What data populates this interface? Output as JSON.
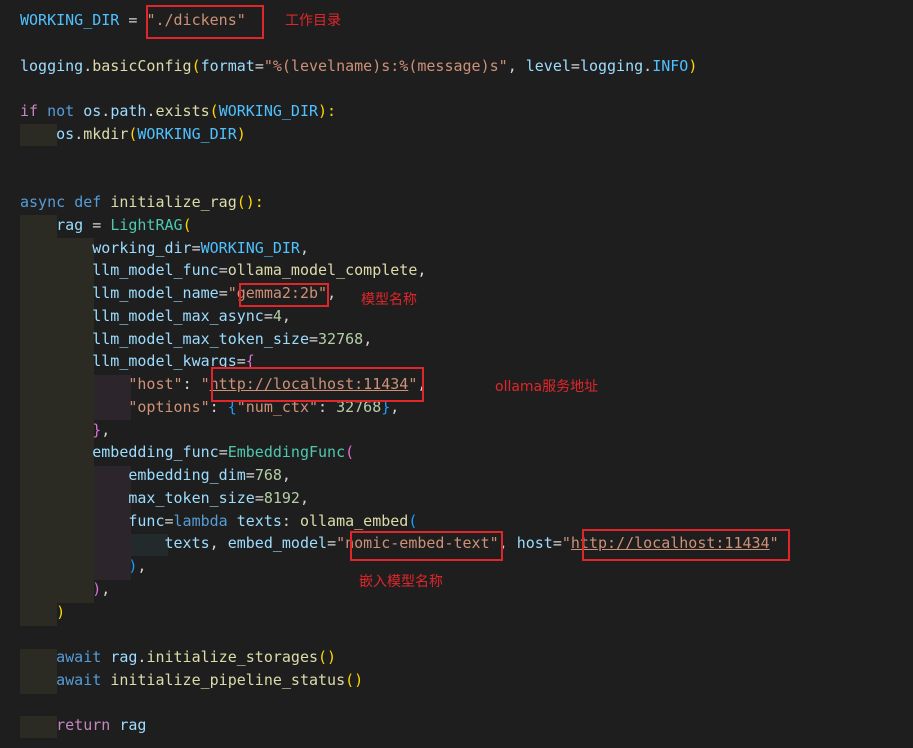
{
  "editor": {
    "lines": [
      [
        [
          "const",
          "WORKING_DIR"
        ],
        [
          "op",
          " = "
        ],
        [
          "str",
          "\"./dickens\""
        ]
      ],
      [],
      [
        [
          "var",
          "logging"
        ],
        [
          "op",
          "."
        ],
        [
          "fn",
          "basicConfig"
        ],
        [
          "p1",
          "("
        ],
        [
          "var",
          "format"
        ],
        [
          "op",
          "="
        ],
        [
          "str",
          "\"%(levelname)s:%(message)s\""
        ],
        [
          "op",
          ", "
        ],
        [
          "var",
          "level"
        ],
        [
          "op",
          "="
        ],
        [
          "var",
          "logging"
        ],
        [
          "op",
          "."
        ],
        [
          "const",
          "INFO"
        ],
        [
          "p1",
          ")"
        ]
      ],
      [],
      [
        [
          "ctrl",
          "if"
        ],
        [
          "op",
          " "
        ],
        [
          "kw",
          "not"
        ],
        [
          "op",
          " "
        ],
        [
          "var",
          "os"
        ],
        [
          "op",
          "."
        ],
        [
          "var",
          "path"
        ],
        [
          "op",
          "."
        ],
        [
          "fn",
          "exists"
        ],
        [
          "p1",
          "("
        ],
        [
          "const",
          "WORKING_DIR"
        ],
        [
          "p1",
          "):"
        ]
      ],
      [
        [
          "op",
          "    "
        ],
        [
          "var",
          "os"
        ],
        [
          "op",
          "."
        ],
        [
          "fn",
          "mkdir"
        ],
        [
          "p1",
          "("
        ],
        [
          "const",
          "WORKING_DIR"
        ],
        [
          "p1",
          ")"
        ]
      ],
      [],
      [],
      [
        [
          "kw",
          "async"
        ],
        [
          "op",
          " "
        ],
        [
          "kw",
          "def"
        ],
        [
          "op",
          " "
        ],
        [
          "fn",
          "initialize_rag"
        ],
        [
          "p1",
          "():"
        ]
      ],
      [
        [
          "op",
          "    "
        ],
        [
          "var",
          "rag"
        ],
        [
          "op",
          " = "
        ],
        [
          "cls",
          "LightRAG"
        ],
        [
          "p1",
          "("
        ]
      ],
      [
        [
          "op",
          "        "
        ],
        [
          "var",
          "working_dir"
        ],
        [
          "op",
          "="
        ],
        [
          "const",
          "WORKING_DIR"
        ],
        [
          "op",
          ","
        ]
      ],
      [
        [
          "op",
          "        "
        ],
        [
          "var",
          "llm_model_func"
        ],
        [
          "op",
          "="
        ],
        [
          "fn",
          "ollama_model_complete"
        ],
        [
          "op",
          ","
        ]
      ],
      [
        [
          "op",
          "        "
        ],
        [
          "var",
          "llm_model_name"
        ],
        [
          "op",
          "="
        ],
        [
          "str",
          "\"gemma2:2b\""
        ],
        [
          "op",
          ","
        ]
      ],
      [
        [
          "op",
          "        "
        ],
        [
          "var",
          "llm_model_max_async"
        ],
        [
          "op",
          "="
        ],
        [
          "num",
          "4"
        ],
        [
          "op",
          ","
        ]
      ],
      [
        [
          "op",
          "        "
        ],
        [
          "var",
          "llm_model_max_token_size"
        ],
        [
          "op",
          "="
        ],
        [
          "num",
          "32768"
        ],
        [
          "op",
          ","
        ]
      ],
      [
        [
          "op",
          "        "
        ],
        [
          "var",
          "llm_model_kwargs"
        ],
        [
          "op",
          "="
        ],
        [
          "p2",
          "{"
        ]
      ],
      [
        [
          "op",
          "            "
        ],
        [
          "str",
          "\"host\""
        ],
        [
          "op",
          ": "
        ],
        [
          "str",
          "\""
        ],
        [
          "str url",
          "http://localhost:11434"
        ],
        [
          "str",
          "\""
        ],
        [
          "op",
          ","
        ]
      ],
      [
        [
          "op",
          "            "
        ],
        [
          "str",
          "\"options\""
        ],
        [
          "op",
          ": "
        ],
        [
          "p3",
          "{"
        ],
        [
          "str",
          "\"num_ctx\""
        ],
        [
          "op",
          ": "
        ],
        [
          "num",
          "32768"
        ],
        [
          "p3",
          "}"
        ],
        [
          "op",
          ","
        ]
      ],
      [
        [
          "op",
          "        "
        ],
        [
          "p2",
          "}"
        ],
        [
          "op",
          ","
        ]
      ],
      [
        [
          "op",
          "        "
        ],
        [
          "var",
          "embedding_func"
        ],
        [
          "op",
          "="
        ],
        [
          "cls",
          "EmbeddingFunc"
        ],
        [
          "p2",
          "("
        ]
      ],
      [
        [
          "op",
          "            "
        ],
        [
          "var",
          "embedding_dim"
        ],
        [
          "op",
          "="
        ],
        [
          "num",
          "768"
        ],
        [
          "op",
          ","
        ]
      ],
      [
        [
          "op",
          "            "
        ],
        [
          "var",
          "max_token_size"
        ],
        [
          "op",
          "="
        ],
        [
          "num",
          "8192"
        ],
        [
          "op",
          ","
        ]
      ],
      [
        [
          "op",
          "            "
        ],
        [
          "var",
          "func"
        ],
        [
          "op",
          "="
        ],
        [
          "kw",
          "lambda"
        ],
        [
          "op",
          " "
        ],
        [
          "var",
          "texts"
        ],
        [
          "op",
          ": "
        ],
        [
          "fn",
          "ollama_embed"
        ],
        [
          "p3",
          "("
        ]
      ],
      [
        [
          "op",
          "                "
        ],
        [
          "var",
          "texts"
        ],
        [
          "op",
          ", "
        ],
        [
          "var",
          "embed_model"
        ],
        [
          "op",
          "="
        ],
        [
          "str",
          "\"nomic-embed-text\""
        ],
        [
          "op",
          ", "
        ],
        [
          "var",
          "host"
        ],
        [
          "op",
          "="
        ],
        [
          "str",
          "\""
        ],
        [
          "str url",
          "http://localhost:11434"
        ],
        [
          "str",
          "\""
        ]
      ],
      [
        [
          "op",
          "            "
        ],
        [
          "p3",
          ")"
        ],
        [
          "op",
          ","
        ]
      ],
      [
        [
          "op",
          "        "
        ],
        [
          "p2",
          ")"
        ],
        [
          "op",
          ","
        ]
      ],
      [
        [
          "op",
          "    "
        ],
        [
          "p1",
          ")"
        ]
      ],
      [],
      [
        [
          "op",
          "    "
        ],
        [
          "kw",
          "await"
        ],
        [
          "op",
          " "
        ],
        [
          "var",
          "rag"
        ],
        [
          "op",
          "."
        ],
        [
          "fn",
          "initialize_storages"
        ],
        [
          "p1",
          "()"
        ]
      ],
      [
        [
          "op",
          "    "
        ],
        [
          "kw",
          "await"
        ],
        [
          "op",
          " "
        ],
        [
          "fn",
          "initialize_pipeline_status"
        ],
        [
          "p1",
          "()"
        ]
      ],
      [],
      [
        [
          "op",
          "    "
        ],
        [
          "ctrl",
          "return"
        ],
        [
          "op",
          " "
        ],
        [
          "var",
          "rag"
        ]
      ]
    ]
  },
  "annotations": {
    "working_dir_note": "工作目录",
    "model_name_note": "模型名称",
    "ollama_service_note": "ollama服务地址",
    "embed_model_note": "嵌入模型名称"
  }
}
